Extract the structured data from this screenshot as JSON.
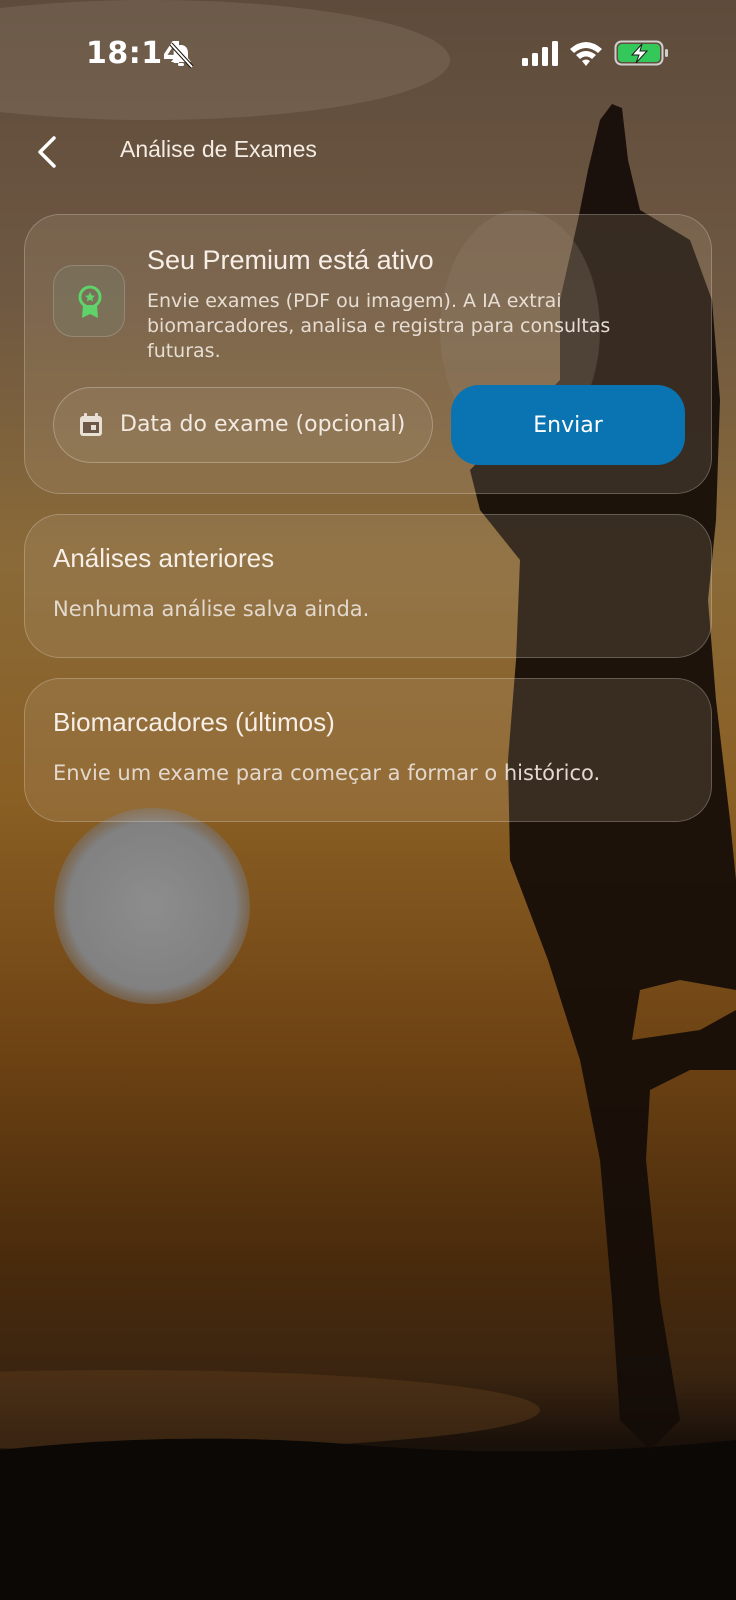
{
  "status_bar": {
    "time": "18:14",
    "icons": [
      "bell-off-icon",
      "cellular-signal-icon",
      "wifi-icon",
      "battery-charging-icon"
    ]
  },
  "header": {
    "back_icon": "chevron-left-icon",
    "title": "Análise de Exames"
  },
  "premium_card": {
    "icon": "award-badge-icon",
    "title": "Seu Premium está ativo",
    "description": "Envie exames (PDF ou imagem). A IA extrai biomarcadores, analisa e registra para consultas futuras.",
    "date_field": {
      "icon": "calendar-icon",
      "placeholder": "Data do exame (opcional)"
    },
    "send_label": "Enviar"
  },
  "previous_analyses": {
    "title": "Análises anteriores",
    "empty_text": "Nenhuma análise salva ainda."
  },
  "biomarkers": {
    "title": "Biomarcadores (últimos)",
    "empty_text": "Envie um exame para começar a formar o histórico."
  },
  "colors": {
    "accent": "#0a73b2",
    "icon_green": "#5fd36a",
    "battery_green": "#34c759"
  }
}
